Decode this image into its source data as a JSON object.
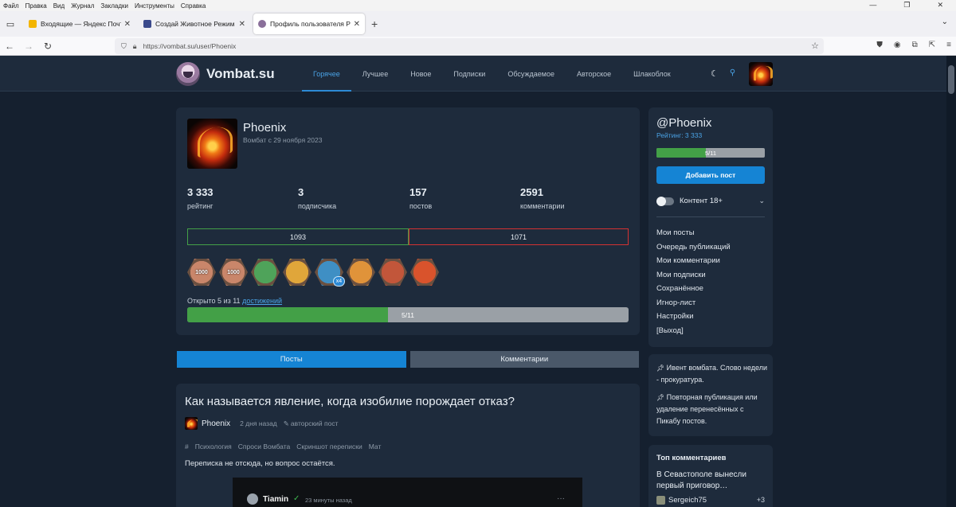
{
  "browser": {
    "menu": [
      "Файл",
      "Правка",
      "Вид",
      "Журнал",
      "Закладки",
      "Инструменты",
      "Справка"
    ],
    "tabs": [
      {
        "title": "Входящие — Яндекс Почта",
        "color": "#f3b500"
      },
      {
        "title": "Создай Животное Режим Бога",
        "color": "#3b4a8c"
      },
      {
        "title": "Профиль пользователя Phoenix",
        "color": "#8a6f9a"
      }
    ],
    "url": "https://vombat.su/user/Phoenix"
  },
  "site": {
    "logo_text": "Vombat.su",
    "nav": [
      "Горячее",
      "Лучшее",
      "Новое",
      "Подписки",
      "Обсуждаемое",
      "Авторское",
      "Шлакоблок"
    ],
    "active_nav": "Горячее"
  },
  "profile": {
    "name": "Phoenix",
    "since": "Вомбат с 29 ноября 2023",
    "stats": [
      {
        "value": "3 333",
        "label": "рейтинг"
      },
      {
        "value": "3",
        "label": "подписчика"
      },
      {
        "value": "157",
        "label": "постов"
      },
      {
        "value": "2591",
        "label": "комментарии"
      }
    ],
    "upvotes": "1093",
    "downvotes": "1071",
    "badges": [
      {
        "text": "1000",
        "color": "#c9866a"
      },
      {
        "text": "1000",
        "color": "#c9866a"
      },
      {
        "text": "",
        "color": "#4fa35a"
      },
      {
        "text": "",
        "color": "#e0a63a"
      },
      {
        "text": "",
        "color": "#3f8fc4"
      },
      {
        "text": "",
        "color": "#e0933a"
      },
      {
        "text": "",
        "color": "#c2563a"
      },
      {
        "text": "",
        "color": "#d9532c"
      }
    ],
    "badge_multiplier": "x4",
    "achievements_prefix": "Открыто 5 из 11",
    "achievements_link": "достижений",
    "achievements_progress_label": "5/11",
    "achievements_fraction": 0.4545
  },
  "tabs": {
    "posts": "Посты",
    "comments": "Комментарии"
  },
  "post": {
    "title": "Как называется явление, когда изобилие порождает отказ?",
    "author": "Phoenix",
    "time": "2 дня назад",
    "type": "авторский пост",
    "tags": [
      "Психология",
      "Спроси Вомбата",
      "Скриншот переписки",
      "Мат"
    ],
    "text": "Переписка не отсюда, но вопрос остаётся.",
    "embed": {
      "name": "Tiamin",
      "time": "23 минуты назад"
    }
  },
  "sidebar": {
    "handle": "@Phoenix",
    "rating": "Рейтинг: 3 333",
    "progress_label": "5/11",
    "add_post": "Добавить пост",
    "content18": "Контент 18+",
    "menu": [
      "Мои посты",
      "Очередь публикаций",
      "Мои комментарии",
      "Мои подписки",
      "Сохранённое",
      "Игнор-лист",
      "Настройки",
      "[Выход]"
    ],
    "announcements": [
      "Ивент вомбата. Слово недели - прокуратура.",
      "Повторная публикация или удаление перенесённых с Пикабу постов."
    ],
    "top_comments_title": "Топ комментариев",
    "top_comment_text": "В Севастополе вынесли первый приговор…",
    "top_comment_user": "Sergeich75",
    "top_comment_score": "+3"
  }
}
